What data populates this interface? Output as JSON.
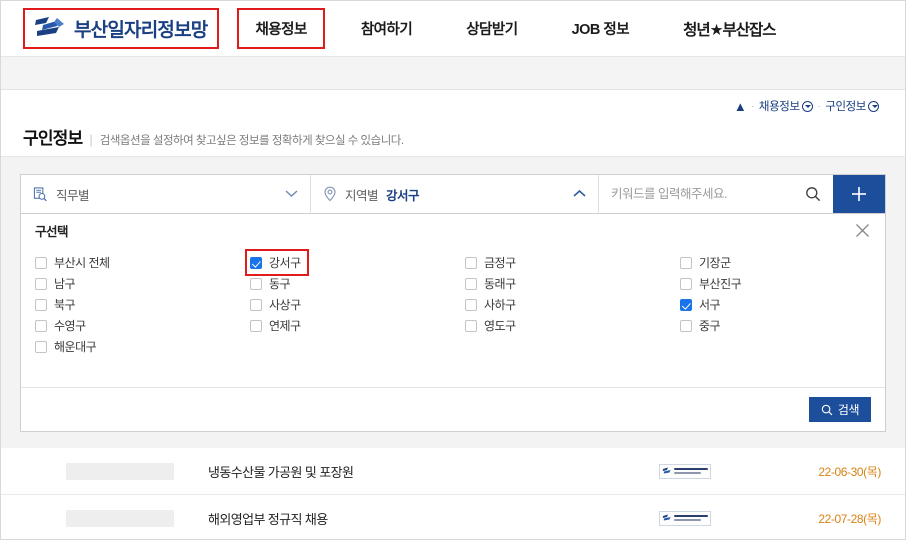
{
  "header": {
    "logo_text": "부산일자리정보망",
    "logo_icon": "busan-job-logo-icon",
    "nav": [
      {
        "label": "채용정보",
        "highlighted": true
      },
      {
        "label": "참여하기",
        "highlighted": false
      },
      {
        "label": "상담받기",
        "highlighted": false
      },
      {
        "label": "JOB 정보",
        "highlighted": false
      },
      {
        "label": "청년★부산잡스",
        "highlighted": false
      }
    ]
  },
  "breadcrumb": {
    "home_icon": "home-icon",
    "items": [
      "채용정보",
      "구인정보"
    ],
    "separator": "·"
  },
  "page_title": {
    "main": "구인정보",
    "separator": "|",
    "sub": "검색옵션을 설정하여 찾고싶은 정보를 정확하게 찾으실 수 있습니다."
  },
  "search_bar": {
    "job_filter": {
      "label": "직무별",
      "icon": "document-search-icon",
      "chevron": "chevron-down-icon"
    },
    "region_filter": {
      "label": "지역별",
      "value": "강서구",
      "icon": "map-pin-icon",
      "chevron": "chevron-up-icon"
    },
    "keyword": {
      "placeholder": "키워드를 입력해주세요.",
      "value": "",
      "icon": "search-icon"
    },
    "add_button": {
      "icon": "plus-icon",
      "color": "#1c4e9c"
    }
  },
  "region_panel": {
    "title": "구선택",
    "close_icon": "close-icon",
    "checkbox_columns": [
      [
        {
          "label": "부산시 전체",
          "checked": false,
          "highlighted": false
        },
        {
          "label": "남구",
          "checked": false,
          "highlighted": false
        },
        {
          "label": "북구",
          "checked": false,
          "highlighted": false
        },
        {
          "label": "수영구",
          "checked": false,
          "highlighted": false
        },
        {
          "label": "해운대구",
          "checked": false,
          "highlighted": false
        }
      ],
      [
        {
          "label": "강서구",
          "checked": true,
          "highlighted": true
        },
        {
          "label": "동구",
          "checked": false,
          "highlighted": false
        },
        {
          "label": "사상구",
          "checked": false,
          "highlighted": false
        },
        {
          "label": "연제구",
          "checked": false,
          "highlighted": false
        }
      ],
      [
        {
          "label": "금정구",
          "checked": false,
          "highlighted": false
        },
        {
          "label": "동래구",
          "checked": false,
          "highlighted": false
        },
        {
          "label": "사하구",
          "checked": false,
          "highlighted": false
        },
        {
          "label": "영도구",
          "checked": false,
          "highlighted": false
        }
      ],
      [
        {
          "label": "기장군",
          "checked": false,
          "highlighted": false
        },
        {
          "label": "부산진구",
          "checked": false,
          "highlighted": false
        },
        {
          "label": "서구",
          "checked": true,
          "highlighted": false
        },
        {
          "label": "중구",
          "checked": false,
          "highlighted": false
        }
      ]
    ],
    "search_button": {
      "label": "검색",
      "icon": "search-icon",
      "color": "#1c4e9c"
    }
  },
  "job_list": {
    "rows": [
      {
        "company": "",
        "title": "냉동수산물 가공원 및 포장원",
        "badge": "busan-city-badge",
        "date": "22-06-30(목)"
      },
      {
        "company": "",
        "title": "해외영업부 정규직 채용",
        "badge": "busan-city-badge",
        "date": "22-07-28(목)"
      }
    ]
  },
  "colors": {
    "accent_blue": "#1c4e9c",
    "checkbox_blue": "#1a73e8",
    "annotation_red": "#e01b1b",
    "date_orange": "#d98214"
  }
}
